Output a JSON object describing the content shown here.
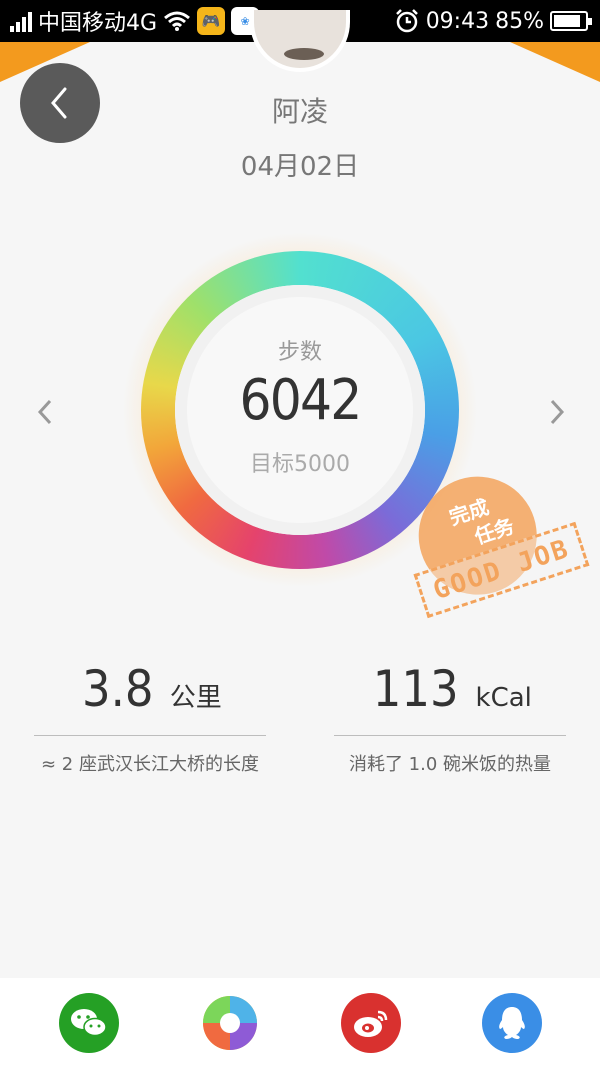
{
  "status_bar": {
    "carrier": "中国移动4G",
    "time": "09:43",
    "battery_percent": "85%",
    "battery_level": 0.85,
    "signal_icon": "signal-bars-icon",
    "wifi_icon": "wifi-icon",
    "alarm_icon": "alarm-clock-icon"
  },
  "header": {
    "back_icon": "chevron-left-icon",
    "name": "阿凌",
    "date": "04月02日"
  },
  "steps": {
    "label": "步数",
    "value": "6042",
    "goal": "目标5000",
    "prev_icon": "chevron-left-icon",
    "next_icon": "chevron-right-icon",
    "ring_colors": [
      "#52e0cf",
      "#4a9fe6",
      "#c04aa8",
      "#f06a40",
      "#e8d84a",
      "#9fe06a"
    ]
  },
  "stamp": {
    "line1": "完成",
    "line2": "任务",
    "text": "GOOD JOB",
    "color": "#f3a35c"
  },
  "stats": {
    "distance": {
      "value": "3.8",
      "unit": "公里",
      "desc": "≈ 2 座武汉长江大桥的长度"
    },
    "calories": {
      "value": "113",
      "unit": "kCal",
      "desc": "消耗了 1.0 碗米饭的热量"
    }
  },
  "share": {
    "buttons": [
      {
        "icon": "wechat-icon",
        "color": "#25a025"
      },
      {
        "icon": "photos-icon",
        "color": "#ffffff"
      },
      {
        "icon": "weibo-icon",
        "color": "#d9312f"
      },
      {
        "icon": "qq-icon",
        "color": "#3a8ee6"
      }
    ]
  }
}
